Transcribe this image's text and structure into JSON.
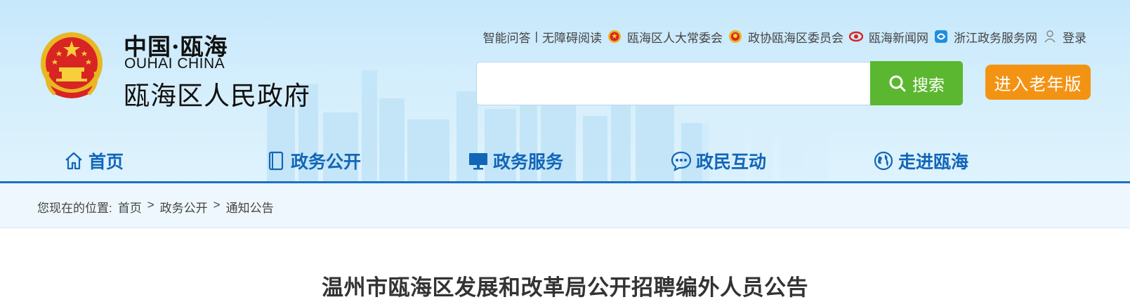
{
  "header": {
    "brand_cn": "中国·瓯海",
    "brand_en": "OUHAI CHINA",
    "brand_gov": "瓯海区人民政府",
    "colors": {
      "bg": "#c6e8fb",
      "nav_blue": "#1266b8",
      "search_green": "#5bb72f",
      "elder_orange": "#f39314"
    }
  },
  "toplinks": {
    "ai_qa": "智能问答",
    "separator": "|",
    "accessible": "无障碍阅读",
    "npc": "瓯海区人大常委会",
    "cppcc": "政协瓯海区委员会",
    "news": "瓯海新闻网",
    "zj_service": "浙江政务服务网",
    "login": "登录"
  },
  "search": {
    "value": "",
    "button_label": "搜索"
  },
  "elder_button": "进入老年版",
  "nav": {
    "items": [
      {
        "label": "首页",
        "icon": "home-icon"
      },
      {
        "label": "政务公开",
        "icon": "document-icon"
      },
      {
        "label": "政务服务",
        "icon": "monitor-icon"
      },
      {
        "label": "政民互动",
        "icon": "chat-icon"
      },
      {
        "label": "走进瓯海",
        "icon": "globe-icon"
      }
    ]
  },
  "breadcrumb": {
    "prefix": "您现在的位置:",
    "items": [
      "首页",
      "政务公开",
      "通知公告"
    ],
    "sep": ">"
  },
  "article": {
    "title": "温州市瓯海区发展和改革局公开招聘编外人员公告"
  }
}
